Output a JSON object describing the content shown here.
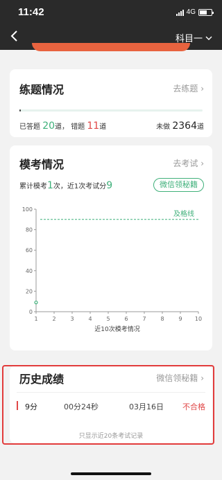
{
  "statusbar": {
    "time": "11:42",
    "network": "4G"
  },
  "navbar": {
    "subject": "科目一"
  },
  "practice": {
    "title": "练题情况",
    "link": "去练题",
    "progress": 0.008,
    "answered_label": "已答题",
    "answered": "20",
    "answered_unit": "道，",
    "wrong_label": "错题",
    "wrong": "11",
    "wrong_unit": "道",
    "undone_label": "未做",
    "undone": "2364",
    "undone_unit": "道"
  },
  "mock": {
    "title": "模考情况",
    "link": "去考试",
    "summary_prefix": "累计模考",
    "count": "1",
    "summary_middle": "次，近1次考试分",
    "last_score": "9",
    "wechat_button": "微信领秘籍"
  },
  "chart_data": {
    "type": "line",
    "x": [
      1
    ],
    "series": [
      {
        "values": [
          9
        ]
      }
    ],
    "xlim": [
      1,
      10
    ],
    "ylim": [
      0,
      100
    ],
    "x_ticks": [
      "1",
      "2",
      "3",
      "4",
      "5",
      "6",
      "7",
      "8",
      "9",
      "10"
    ],
    "y_ticks": [
      "0",
      "20",
      "40",
      "60",
      "80",
      "100"
    ],
    "xlabel": "近10次模考情况",
    "ylabel": "",
    "pass_line": {
      "value": 90,
      "label": "及格线"
    },
    "grid": false,
    "colors": {
      "series": "#3fb07a",
      "pass_line": "#3fb07a",
      "axis": "#999999"
    }
  },
  "history": {
    "title": "历史成绩",
    "link": "微信领秘籍",
    "records": [
      {
        "score": "9分",
        "duration": "00分24秒",
        "date": "03月16日",
        "result": "不合格"
      }
    ],
    "note": "只显示近20条考试记录"
  },
  "colors": {
    "green": "#3fb07a",
    "red": "#e04848",
    "highlight": "#e23b3b"
  }
}
